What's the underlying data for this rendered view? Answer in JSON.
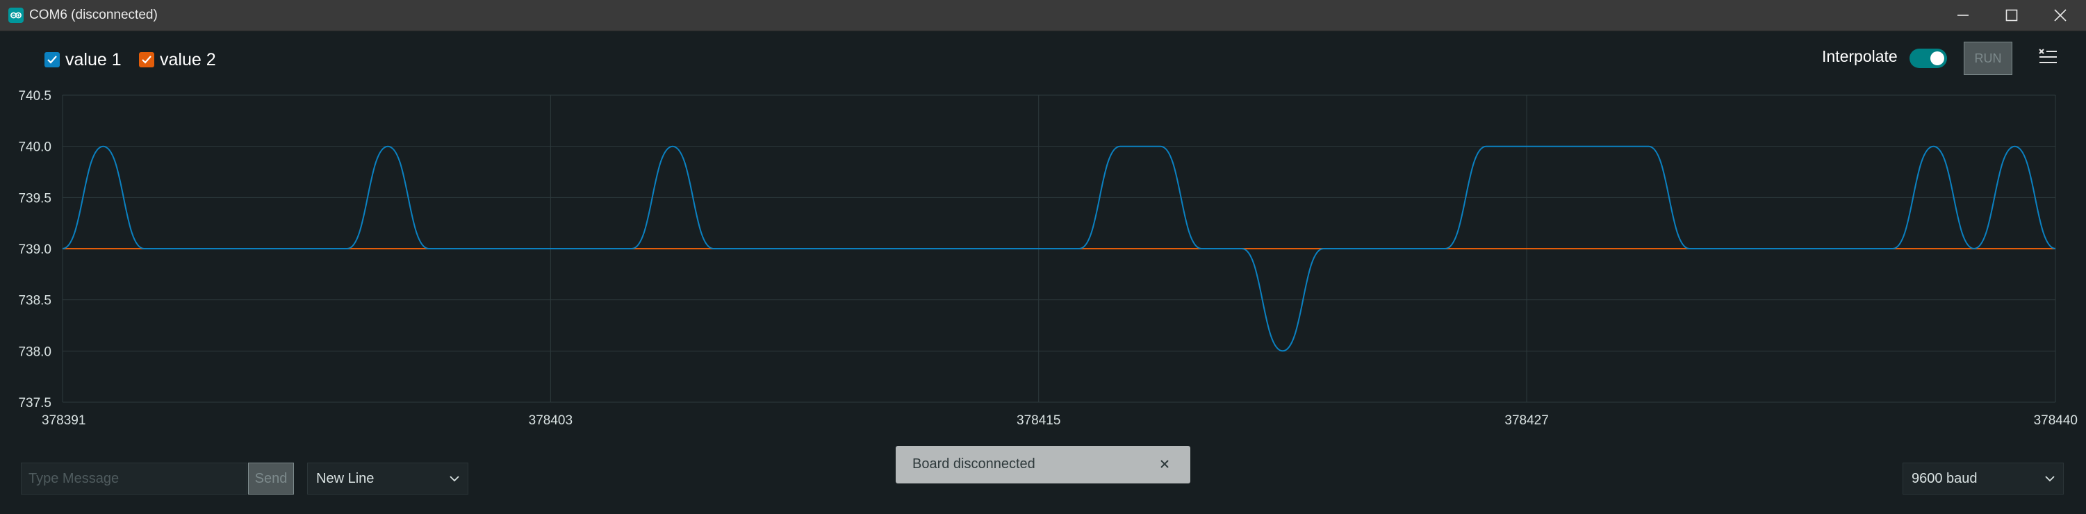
{
  "window": {
    "title": "COM6 (disconnected)",
    "logo_icon": "arduino-logo-icon",
    "controls": [
      "minimize-icon",
      "maximize-icon",
      "close-icon"
    ]
  },
  "legend": [
    {
      "label": "value 1",
      "color": "#0b81c1",
      "checked": true
    },
    {
      "label": "value 2",
      "color": "#e35d0a",
      "checked": true
    }
  ],
  "header": {
    "interpolate_label": "Interpolate",
    "interpolate_on": true,
    "run_label": "RUN",
    "clear_icon": "clear-list-icon"
  },
  "chart_data": {
    "type": "line",
    "title": "",
    "xlabel": "",
    "ylabel": "",
    "xlim": [
      378391,
      378440
    ],
    "ylim": [
      737.5,
      740.5
    ],
    "y_ticks": [
      "740.5",
      "740.0",
      "739.5",
      "739.0",
      "738.5",
      "738.0",
      "737.5"
    ],
    "x_ticks": [
      "378391",
      "378403",
      "378415",
      "378427",
      "378440"
    ],
    "grid": true,
    "series": [
      {
        "name": "value 1",
        "color": "#0b81c1",
        "points": [
          [
            378391,
            739
          ],
          [
            378392,
            740
          ],
          [
            378393,
            739
          ],
          [
            378398,
            739
          ],
          [
            378399,
            740
          ],
          [
            378400,
            739
          ],
          [
            378405,
            739
          ],
          [
            378406,
            740
          ],
          [
            378407,
            739
          ],
          [
            378416,
            739
          ],
          [
            378417,
            740
          ],
          [
            378418,
            740
          ],
          [
            378419,
            739
          ],
          [
            378420,
            739
          ],
          [
            378421,
            738
          ],
          [
            378422,
            739
          ],
          [
            378425,
            739
          ],
          [
            378426,
            740
          ],
          [
            378430,
            740
          ],
          [
            378431,
            739
          ],
          [
            378436,
            739
          ],
          [
            378437,
            740
          ],
          [
            378438,
            739
          ],
          [
            378439,
            740
          ],
          [
            378440,
            739
          ]
        ]
      },
      {
        "name": "value 2",
        "color": "#e35d0a",
        "points": [
          [
            378391,
            739
          ],
          [
            378440,
            739
          ]
        ]
      }
    ]
  },
  "footer": {
    "message_placeholder": "Type Message",
    "send_label": "Send",
    "line_ending": "New Line",
    "baud_rate": "9600 baud",
    "toast_text": "Board disconnected"
  }
}
